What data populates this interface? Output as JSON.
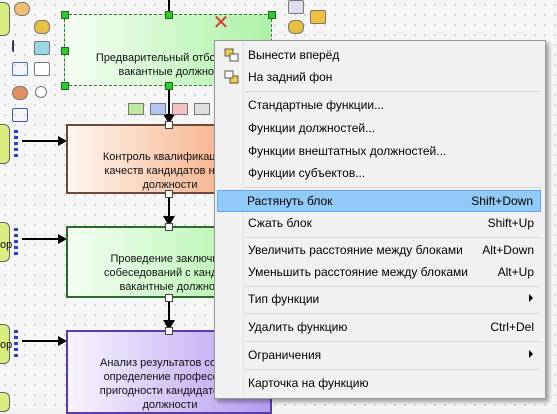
{
  "diagram": {
    "blocks": [
      {
        "id": "b1",
        "text": "Предварительный отбор кан\nвакантные должнос",
        "fill": "#aef2a8",
        "selected": true
      },
      {
        "id": "b2",
        "text": "Контроль квалификации и\nкачеств кандидатов на ва\nдолжности",
        "fill": "#f4b38a"
      },
      {
        "id": "b3",
        "text": "Проведение заключите\nсобеседований с кандида\nвакантные должнос",
        "fill": "#aef2a8"
      },
      {
        "id": "b4",
        "text": "Анализ результатов собесе\nопределение профессион\nпригодности кандидатов на\nдолжности",
        "fill": "#c7b2f3"
      }
    ],
    "left_labels": [
      "ор",
      "ор"
    ],
    "colors": {
      "selection_handle": "#32c832",
      "connector": "#000000",
      "delete_icon": "#d83a2a"
    }
  },
  "context_menu": {
    "items": [
      {
        "label": "Вынести вперёд",
        "icon": "bring-to-front-icon"
      },
      {
        "label": "На задний фон",
        "icon": "send-to-back-icon"
      },
      {
        "separator": true
      },
      {
        "label": "Стандартные функции..."
      },
      {
        "label": "Функции должностей..."
      },
      {
        "label": "Функции внештатных должностей..."
      },
      {
        "label": "Функции субъектов..."
      },
      {
        "separator": true
      },
      {
        "label": "Растянуть блок",
        "shortcut": "Shift+Down",
        "highlighted": true
      },
      {
        "label": "Сжать блок",
        "shortcut": "Shift+Up"
      },
      {
        "separator": true
      },
      {
        "label": "Увеличить расстояние между блоками",
        "shortcut": "Alt+Down"
      },
      {
        "label": "Уменьшить расстояние между блоками",
        "shortcut": "Alt+Up"
      },
      {
        "separator": true
      },
      {
        "label": "Тип функции",
        "submenu": true
      },
      {
        "separator": true
      },
      {
        "label": "Удалить функцию",
        "shortcut": "Ctrl+Del"
      },
      {
        "separator": true
      },
      {
        "label": "Ограничения",
        "submenu": true
      },
      {
        "separator": true
      },
      {
        "label": "Карточка на функцию"
      }
    ]
  }
}
